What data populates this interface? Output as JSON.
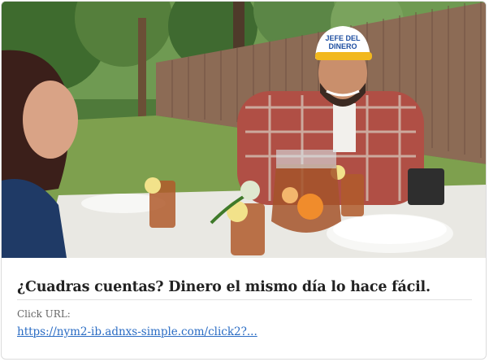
{
  "ad": {
    "image_alt": "Dos personas sentadas a una mesa al aire libre con una jarra de té helado; el hombre lleva una gorra que dice JEFE DEL DINERO",
    "cap_text_line1": "JEFE DEL",
    "cap_text_line2": "DINERO",
    "headline": "¿Cuadras cuentas? Dinero el mismo día lo hace fácil.",
    "click_label": "Click URL:",
    "click_url": "https://nym2-ib.adnxs-simple.com/click2?..."
  },
  "colors": {
    "link": "#2a6cc4",
    "headline": "#222222",
    "label": "#666666",
    "border": "#dcdcdc"
  }
}
